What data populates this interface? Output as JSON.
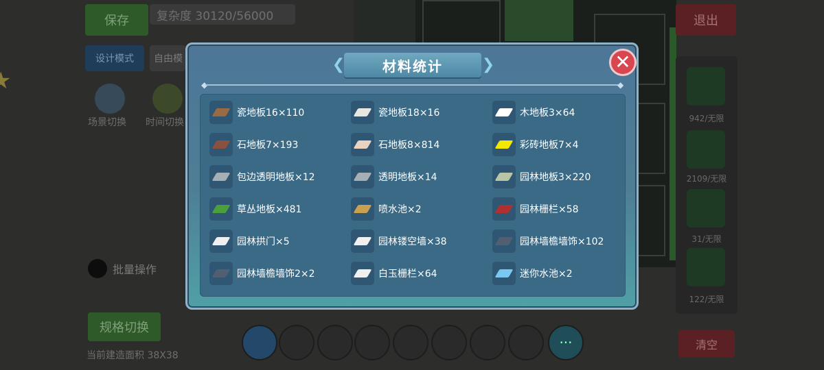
{
  "background": {
    "save_label": "保存",
    "complexity_text": "复杂度 30120/56000",
    "design_mode_label": "设计模式",
    "free_mode_label": "自由模",
    "scene_switch_label": "场景切换",
    "time_switch_label": "时间切换",
    "exit_label": "退出",
    "batch_label": "批量操作",
    "spec_switch_label": "规格切换",
    "build_area_text": "当前建造面积 38X38",
    "clear_label": "清空",
    "more_label": "···",
    "right_panel": [
      "942/无限",
      "2109/无限",
      "31/无限",
      "122/无限"
    ]
  },
  "modal": {
    "title": "材料统计",
    "close_label": "✕",
    "items": [
      {
        "name": "瓷地板16×110",
        "icon": "tile-floor-brown-icon",
        "color": "#9a6a44"
      },
      {
        "name": "瓷地板18×16",
        "icon": "tile-floor-white-icon",
        "color": "#e8e8e0"
      },
      {
        "name": "木地板3×64",
        "icon": "wood-floor-icon",
        "color": "#ffffff"
      },
      {
        "name": "石地板7×193",
        "icon": "stone-floor-brown-icon",
        "color": "#8a5040"
      },
      {
        "name": "石地板8×814",
        "icon": "stone-floor-beige-icon",
        "color": "#e8d2c0"
      },
      {
        "name": "彩砖地板7×4",
        "icon": "color-brick-floor-icon",
        "color": "#f4e800"
      },
      {
        "name": "包边透明地板×12",
        "icon": "edged-glass-floor-icon",
        "color": "#a6aeb6"
      },
      {
        "name": "透明地板×14",
        "icon": "glass-floor-icon",
        "color": "#a6aeb6"
      },
      {
        "name": "园林地板3×220",
        "icon": "garden-floor-icon",
        "color": "#b8c6a6"
      },
      {
        "name": "草丛地板×481",
        "icon": "grass-floor-icon",
        "color": "#4aa03a"
      },
      {
        "name": "喷水池×2",
        "icon": "fountain-icon",
        "color": "#c8a050"
      },
      {
        "name": "园林栅栏×58",
        "icon": "garden-fence-icon",
        "color": "#b03030"
      },
      {
        "name": "园林拱门×5",
        "icon": "garden-arch-icon",
        "color": "#f0f0f0"
      },
      {
        "name": "园林镂空墙×38",
        "icon": "garden-hollow-wall-icon",
        "color": "#f0f0f0"
      },
      {
        "name": "园林墙檐墙饰×102",
        "icon": "garden-eave-icon",
        "color": "#506070"
      },
      {
        "name": "园林墙檐墙饰2×2",
        "icon": "garden-eave-2-icon",
        "color": "#506070"
      },
      {
        "name": "白玉栅栏×64",
        "icon": "white-jade-fence-icon",
        "color": "#f0f0f0"
      },
      {
        "name": "迷你水池×2",
        "icon": "mini-pool-icon",
        "color": "#7ac8f0"
      }
    ]
  }
}
